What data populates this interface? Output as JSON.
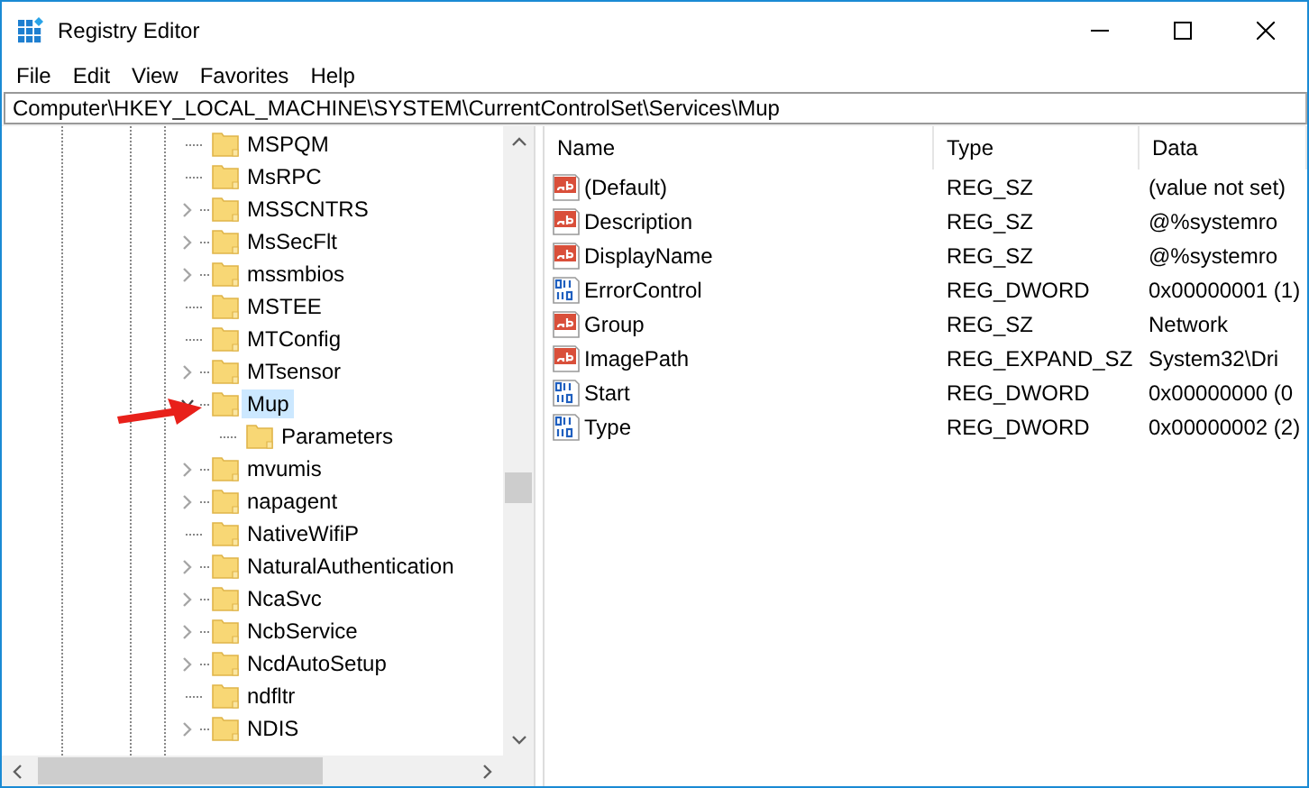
{
  "window": {
    "title": "Registry Editor"
  },
  "menu": [
    "File",
    "Edit",
    "View",
    "Favorites",
    "Help"
  ],
  "address": "Computer\\HKEY_LOCAL_MACHINE\\SYSTEM\\CurrentControlSet\\Services\\Mup",
  "tree": [
    {
      "label": "MSPQM",
      "kind": "leaf",
      "selected": false
    },
    {
      "label": "MsRPC",
      "kind": "leaf",
      "selected": false
    },
    {
      "label": "MSSCNTRS",
      "kind": "collapsed",
      "selected": false
    },
    {
      "label": "MsSecFlt",
      "kind": "collapsed",
      "selected": false
    },
    {
      "label": "mssmbios",
      "kind": "collapsed",
      "selected": false
    },
    {
      "label": "MSTEE",
      "kind": "leaf",
      "selected": false
    },
    {
      "label": "MTConfig",
      "kind": "leaf",
      "selected": false
    },
    {
      "label": "MTsensor",
      "kind": "collapsed",
      "selected": false
    },
    {
      "label": "Mup",
      "kind": "expanded",
      "selected": true,
      "children": [
        {
          "label": "Parameters",
          "kind": "leaf",
          "selected": false
        }
      ]
    },
    {
      "label": "mvumis",
      "kind": "collapsed",
      "selected": false
    },
    {
      "label": "napagent",
      "kind": "collapsed",
      "selected": false
    },
    {
      "label": "NativeWifiP",
      "kind": "leaf",
      "selected": false
    },
    {
      "label": "NaturalAuthentication",
      "kind": "collapsed",
      "selected": false
    },
    {
      "label": "NcaSvc",
      "kind": "collapsed",
      "selected": false
    },
    {
      "label": "NcbService",
      "kind": "collapsed",
      "selected": false
    },
    {
      "label": "NcdAutoSetup",
      "kind": "collapsed",
      "selected": false
    },
    {
      "label": "ndfltr",
      "kind": "leaf",
      "selected": false
    },
    {
      "label": "NDIS",
      "kind": "collapsed",
      "selected": false
    }
  ],
  "values": {
    "columns": [
      "Name",
      "Type",
      "Data"
    ],
    "rows": [
      {
        "kind": "string",
        "name": "(Default)",
        "type": "REG_SZ",
        "data": "(value not set)"
      },
      {
        "kind": "string",
        "name": "Description",
        "type": "REG_SZ",
        "data": "@%systemro"
      },
      {
        "kind": "string",
        "name": "DisplayName",
        "type": "REG_SZ",
        "data": "@%systemro"
      },
      {
        "kind": "binary",
        "name": "ErrorControl",
        "type": "REG_DWORD",
        "data": "0x00000001 (1)"
      },
      {
        "kind": "string",
        "name": "Group",
        "type": "REG_SZ",
        "data": "Network"
      },
      {
        "kind": "string",
        "name": "ImagePath",
        "type": "REG_EXPAND_SZ",
        "data": "System32\\Dri"
      },
      {
        "kind": "binary",
        "name": "Start",
        "type": "REG_DWORD",
        "data": "0x00000000 (0"
      },
      {
        "kind": "binary",
        "name": "Type",
        "type": "REG_DWORD",
        "data": "0x00000002 (2)"
      }
    ]
  }
}
